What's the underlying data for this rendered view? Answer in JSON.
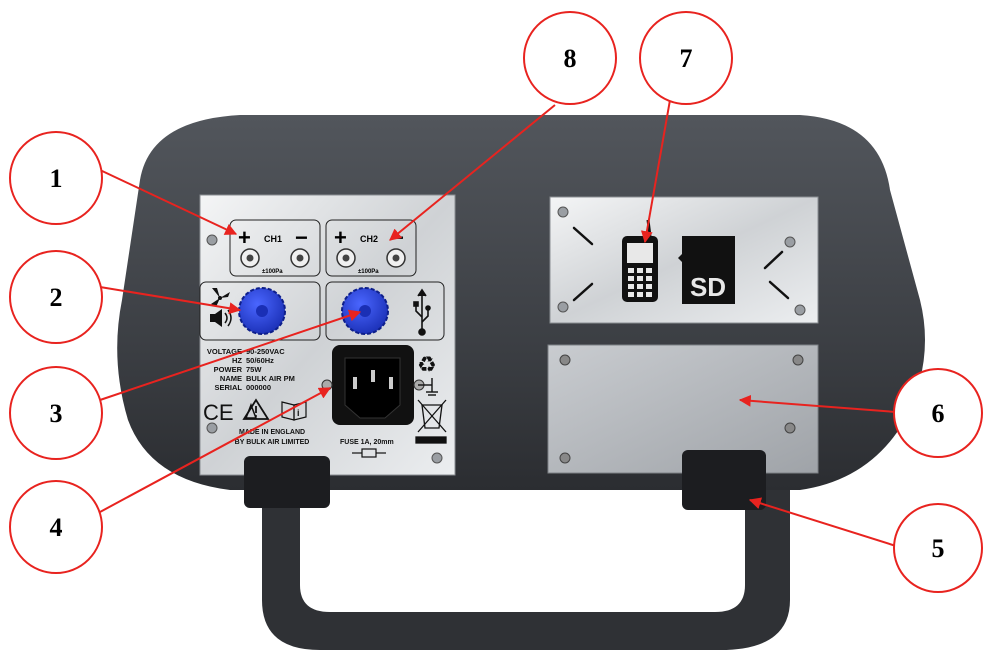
{
  "callouts": [
    {
      "id": "1",
      "label": "1"
    },
    {
      "id": "2",
      "label": "2"
    },
    {
      "id": "3",
      "label": "3"
    },
    {
      "id": "4",
      "label": "4"
    },
    {
      "id": "5",
      "label": "5"
    },
    {
      "id": "6",
      "label": "6"
    },
    {
      "id": "7",
      "label": "7"
    },
    {
      "id": "8",
      "label": "8"
    }
  ],
  "left_panel": {
    "ch1_label": "CH1",
    "ch2_label": "CH2",
    "ch1_range": "±100Pa",
    "ch2_range": "±100Pa",
    "specs": [
      {
        "key": "VOLTAGE",
        "value": "90-250VAC"
      },
      {
        "key": "HZ",
        "value": "50/60Hz"
      },
      {
        "key": "POWER",
        "value": "75W"
      },
      {
        "key": "NAME",
        "value": "BULK AIR PM"
      },
      {
        "key": "SERIAL",
        "value": "000000"
      }
    ],
    "ce_mark": "CE",
    "made_in_line1": "MADE IN ENGLAND",
    "made_in_line2": "BY BULK AIR LIMITED",
    "fuse_label": "FUSE 1A, 20mm"
  },
  "right_panel": {
    "sd_label": "SD"
  },
  "colors": {
    "body_dark": "#3a3d42",
    "plate_silver": "#d9dbde",
    "knob_blue": "#2340d8",
    "callout_red": "#e8231f"
  }
}
